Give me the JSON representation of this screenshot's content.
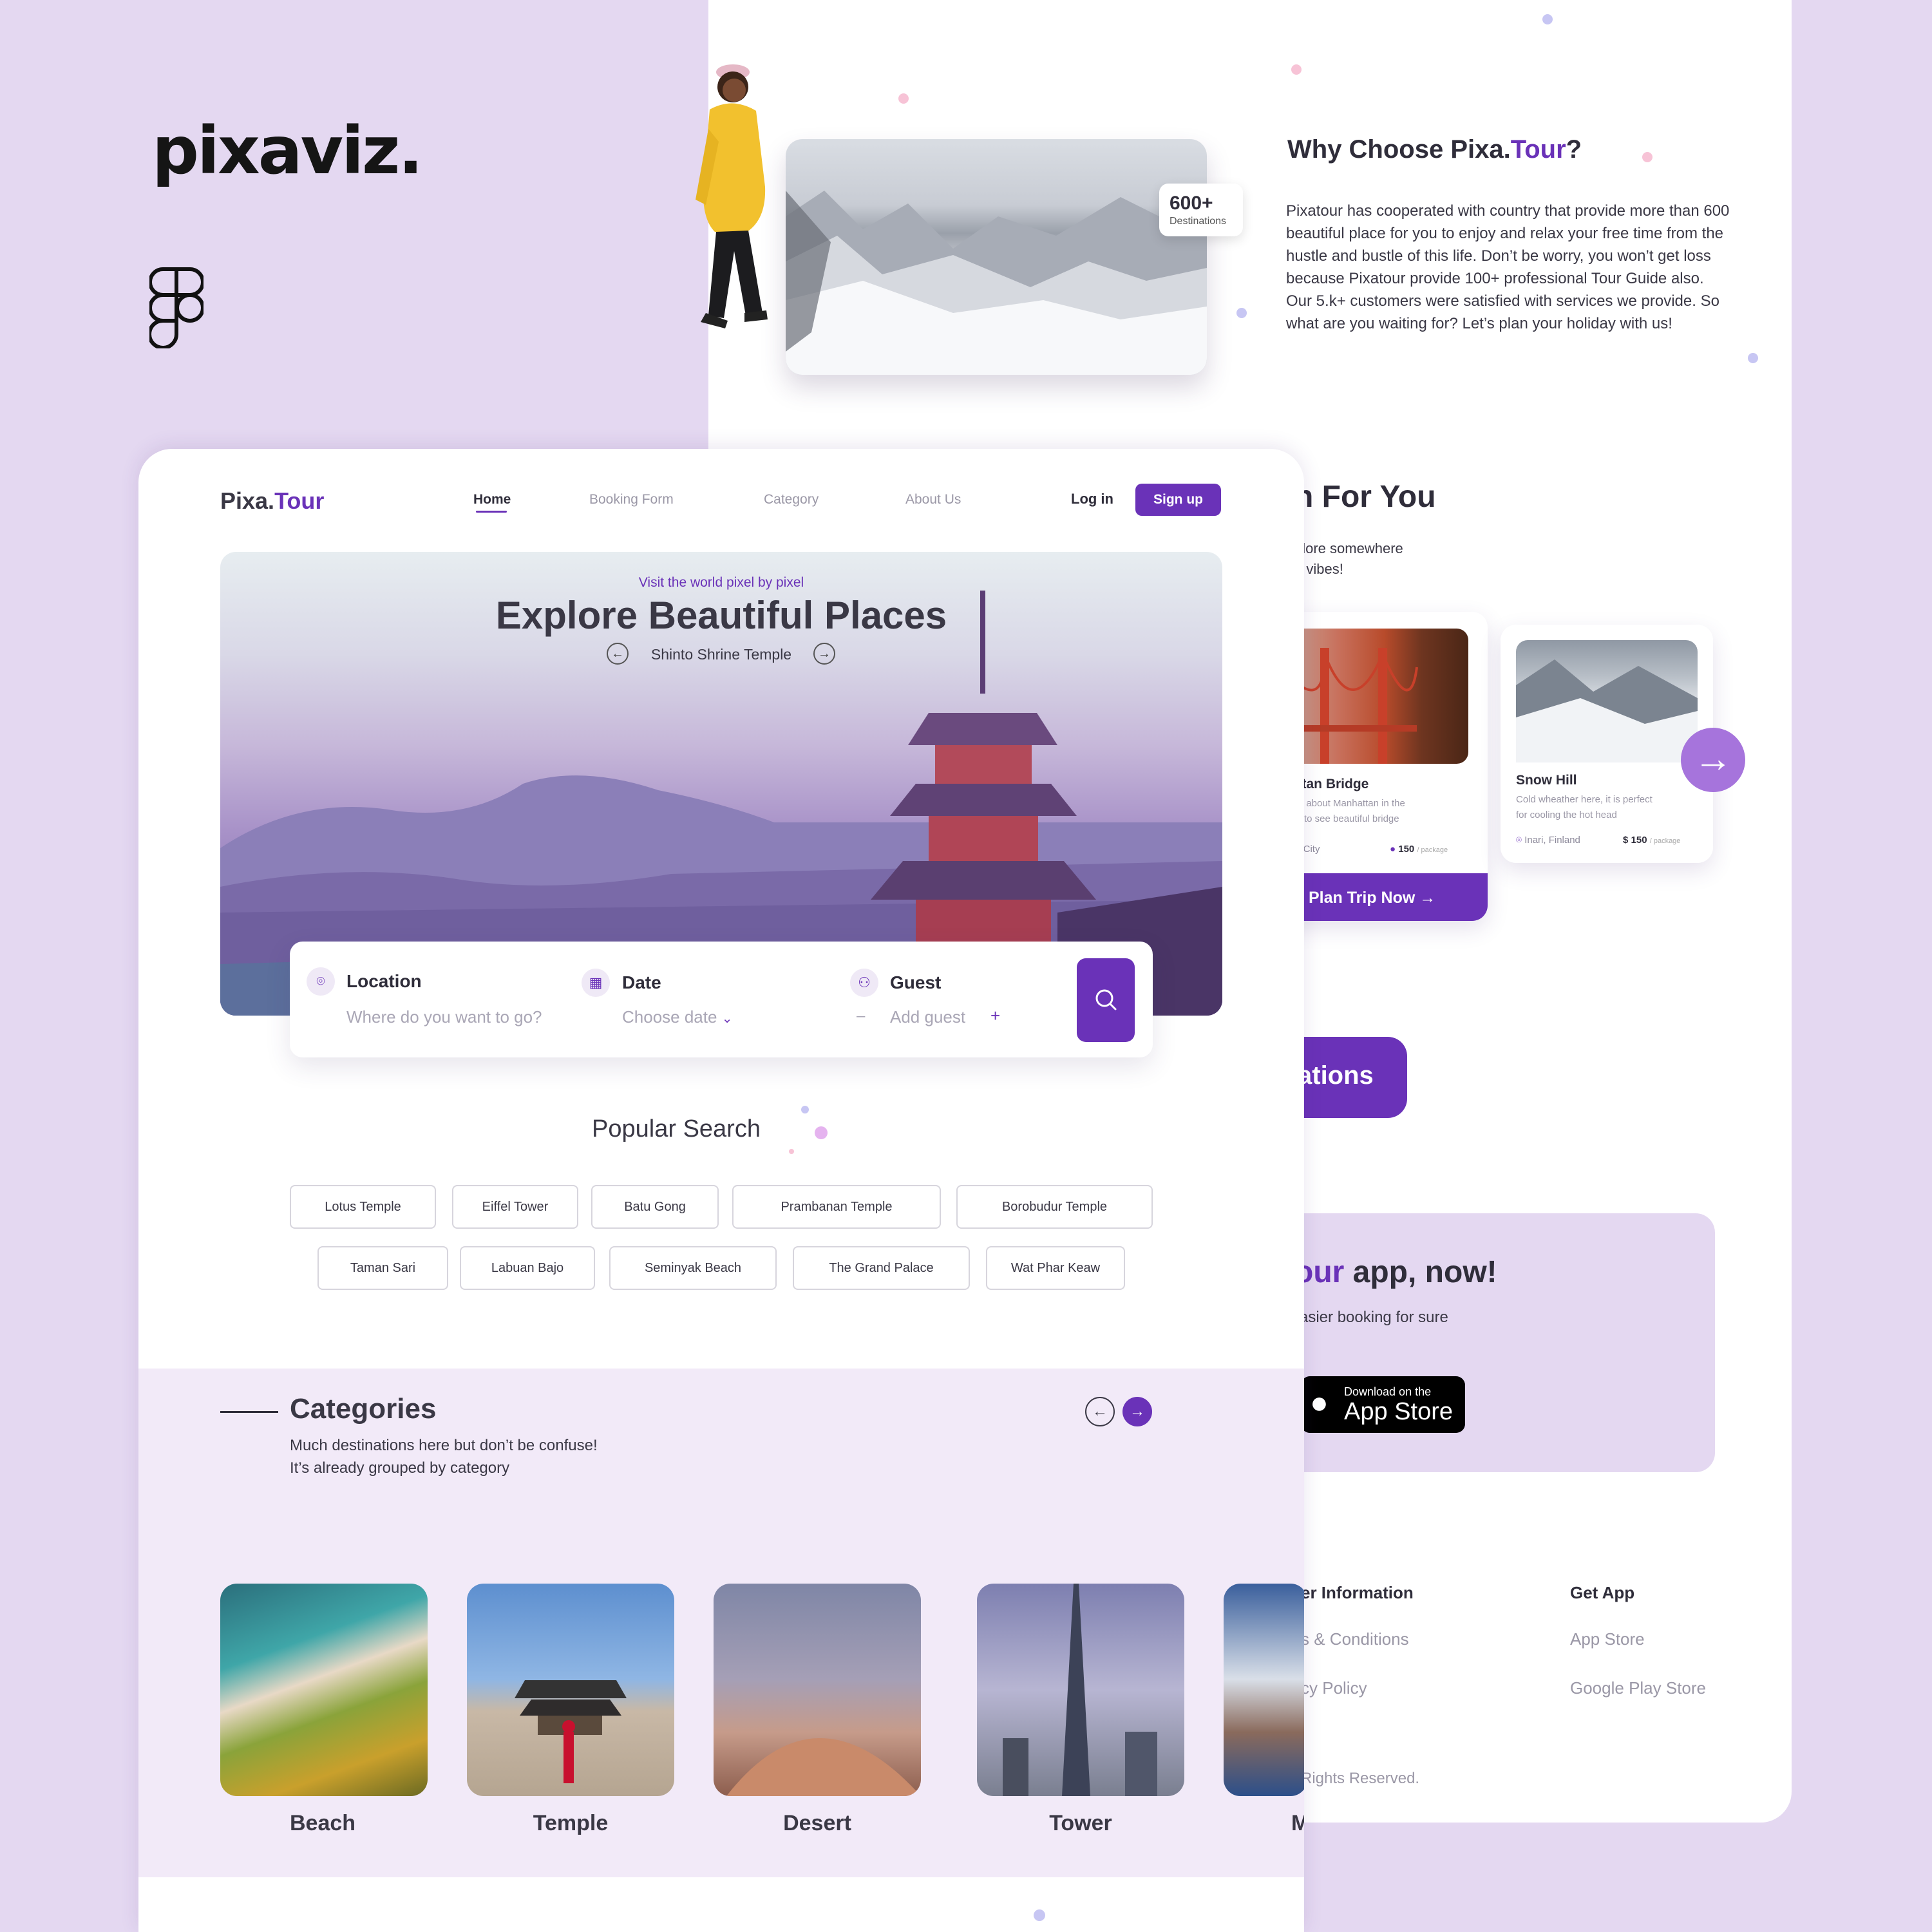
{
  "brand": {
    "name": "pixaviz."
  },
  "back_page": {
    "badge": {
      "count": "600+",
      "label": "Destinations"
    },
    "why": {
      "title_prefix": "Why Choose Pixa.",
      "title_accent": "Tour",
      "title_suffix": "?",
      "body": "Pixatour has cooperated with country that provide more than 600 beautiful place for you to enjoy and relax your free time from the hustle and bustle of this life. Don’t be worry, you won’t get loss because Pixatour provide 100+ professional Tour Guide also.\nOur 5.k+ customers were satisfied with services we provide. So what are you waiting for? Let’s plan your holiday with us!"
    },
    "for_you": {
      "title": "n For You",
      "sub_line1": "plore somewhere",
      "sub_line2": "e vibes!"
    },
    "cards": [
      {
        "title": "hattan Bridge",
        "desc_line1": "more about Manhattan in the",
        "desc_line2": "f city to see beautiful bridge",
        "location": "York City",
        "price": "150",
        "unit": "/ package"
      },
      {
        "title": "Snow Hill",
        "desc_line1": "Cold wheather here, it is perfect",
        "desc_line2": "for cooling the hot head",
        "location": "Inari, Finland",
        "price": "$ 150",
        "unit": "/ package"
      }
    ],
    "plan_button": "Plan Trip Now",
    "destinations_button": "ations",
    "app": {
      "title_accent": "our",
      "title_rest": " app, now!",
      "sub": "asier booking for sure",
      "store_small": "Download on the",
      "store_big": "App Store"
    },
    "footer": {
      "col1_title": "er Information",
      "col1_links": [
        "s & Conditions",
        "cy Policy"
      ],
      "col2_title": "Get App",
      "col2_links": [
        "App Store",
        "Google Play Store"
      ],
      "copyright": "Rights Reserved."
    }
  },
  "front_page": {
    "logo_prefix": "Pixa.",
    "logo_accent": "Tour",
    "nav": [
      "Home",
      "Booking Form",
      "Category",
      "About Us"
    ],
    "login": "Log in",
    "signup": "Sign up",
    "hero": {
      "kicker": "Visit the world pixel by pixel",
      "title": "Explore Beautiful Places",
      "subtitle": "Shinto Shrine Temple"
    },
    "search": {
      "location_label": "Location",
      "location_placeholder": "Where do you want to go?",
      "date_label": "Date",
      "date_placeholder": "Choose date",
      "guest_label": "Guest",
      "guest_placeholder": "Add guest",
      "guest_minus": "–",
      "guest_plus": "+"
    },
    "popular": {
      "title": "Popular Search",
      "row1": [
        "Lotus Temple",
        "Eiffel Tower",
        "Batu Gong",
        "Prambanan Temple",
        "Borobudur Temple"
      ],
      "row2": [
        "Taman Sari",
        "Labuan Bajo",
        "Seminyak Beach",
        "The Grand Palace",
        "Wat Phar Keaw"
      ]
    },
    "categories": {
      "title": "Categories",
      "sub_line1": "Much destinations here but don’t be confuse!",
      "sub_line2": "It’s already grouped by category",
      "items": [
        "Beach",
        "Temple",
        "Desert",
        "Tower",
        "M"
      ]
    }
  },
  "colors": {
    "accent": "#6a32b8",
    "lavender_bg": "#e4d8f1",
    "category_bg": "#f2eaf8",
    "text": "#2f2d3a"
  }
}
